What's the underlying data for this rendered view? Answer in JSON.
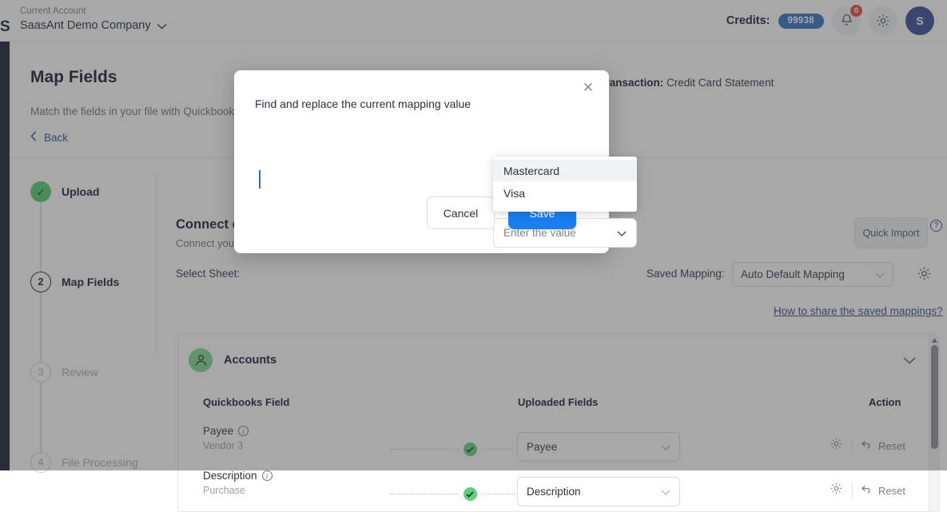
{
  "header": {
    "logo_letter": "S",
    "account_label": "Current Account",
    "account_name": "SaasAnt Demo Company",
    "account_chevron_icon": "chevron-down-icon",
    "credits_label": "Credits:",
    "credits_value": "99938",
    "notification_icon": "bell-icon",
    "notification_badge": "0",
    "settings_icon": "gear-icon",
    "avatar_letter": "S"
  },
  "page": {
    "title": "Map Fields",
    "subtitle": "Match the fields in your file with Quickbooks fields",
    "transaction_prefix": "Transaction:",
    "transaction_type": "Credit Card Statement",
    "back_label": "Back",
    "back_icon": "chevron-left-icon"
  },
  "stepper": {
    "steps": [
      {
        "num": "✓",
        "label": "Upload",
        "state": "done"
      },
      {
        "num": "2",
        "label": "Map Fields",
        "state": "active"
      },
      {
        "num": "3",
        "label": "Review",
        "state": "idle"
      },
      {
        "num": "4",
        "label": "File Processing",
        "state": "idle"
      }
    ]
  },
  "connect": {
    "title": "Connect data",
    "subtitle": "Connect your Quickbooks data",
    "select_sheet_label": "Select Sheet:",
    "quick_import_label": "Quick Import",
    "help_icon": "question-mark-icon",
    "saved_mapping_label": "Saved Mapping:",
    "saved_mapping_value": "Auto Default Mapping",
    "saved_mapping_chevron_icon": "chevron-down-icon",
    "saved_mapping_gear_icon": "gear-icon",
    "share_link_label": "How to share the saved mappings?"
  },
  "accounts_card": {
    "section_icon": "user-icon",
    "section_title": "Accounts",
    "collapse_icon": "chevron-down-icon",
    "columns": {
      "quickbooks_field": "Quickbooks Field",
      "uploaded_fields": "Uploaded Fields",
      "action": "Action"
    },
    "rows": [
      {
        "field": "Payee",
        "info_icon": "info-icon",
        "sample": "Vendor 3",
        "status_icon": "check-circle-icon",
        "uploaded_value": "Payee",
        "uploaded_chevron_icon": "chevron-down-icon",
        "gear_icon": "gear-icon",
        "reset_icon": "undo-arrow-icon",
        "reset_label": "Reset"
      },
      {
        "field": "Description",
        "info_icon": "info-icon",
        "sample": "Purchase",
        "status_icon": "check-circle-icon",
        "uploaded_value": "Description",
        "uploaded_chevron_icon": "chevron-down-icon",
        "gear_icon": "gear-icon",
        "reset_icon": "undo-arrow-icon",
        "reset_label": "Reset"
      }
    ],
    "scrollbar_up_icon": "scroll-up-arrow-icon"
  },
  "modal": {
    "close_icon": "close-icon",
    "description": "Find and replace the current mapping value",
    "select_placeholder": "Enter the value",
    "select_chevron_icon": "chevron-down-icon",
    "dropdown_options": [
      {
        "label": "Mastercard",
        "highlighted": true
      },
      {
        "label": "Visa",
        "highlighted": false
      }
    ],
    "cancel_label": "Cancel",
    "save_label": "Save"
  },
  "colors": {
    "accent_blue": "#1a7ef0",
    "brand_navy": "#10172a",
    "credits_pill": "#2b6fc4",
    "success_green": "#4fcc6e",
    "badge_red": "#e8453c",
    "link_blue": "#2f4793"
  }
}
